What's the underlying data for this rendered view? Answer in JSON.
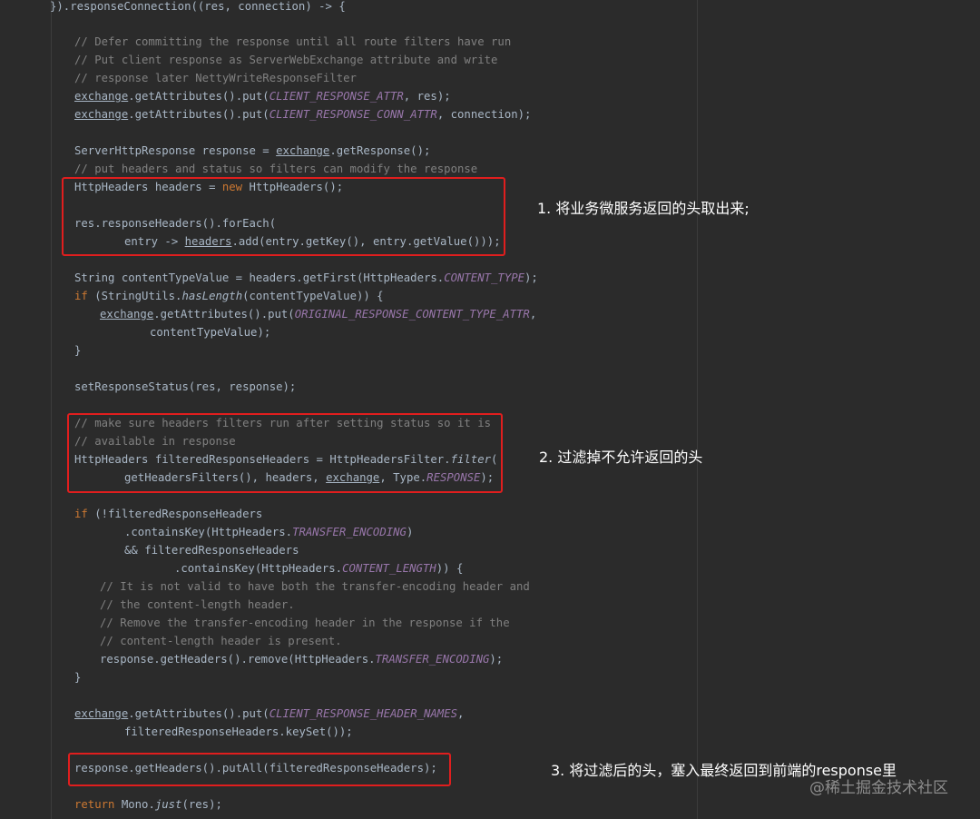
{
  "code": {
    "l0": [
      "}).responseConnection((res, connection) -> {"
    ],
    "l2": [
      "// Defer committing the response until all route filters have run"
    ],
    "l3": [
      "// Put client response as ServerWebExchange attribute and write"
    ],
    "l4": [
      "// response later NettyWriteResponseFilter"
    ],
    "l5": [
      "exchange",
      ".getAttributes().put(",
      "CLIENT_RESPONSE_ATTR",
      ", res);"
    ],
    "l6": [
      "exchange",
      ".getAttributes().put(",
      "CLIENT_RESPONSE_CONN_ATTR",
      ", connection);"
    ],
    "l8": [
      "ServerHttpResponse response = ",
      "exchange",
      ".getResponse();"
    ],
    "l9": [
      "// put headers and status so filters can modify the response"
    ],
    "l10": [
      "HttpHeaders headers = ",
      "new",
      " HttpHeaders();"
    ],
    "l12": [
      "res.responseHeaders().forEach("
    ],
    "l13": [
      "entry -> ",
      "headers",
      ".add(entry.getKey(), entry.getValue()));"
    ],
    "l15": [
      "String contentTypeValue = headers.getFirst(HttpHeaders.",
      "CONTENT_TYPE",
      ");"
    ],
    "l16": [
      "if",
      " (StringUtils.",
      "hasLength",
      "(contentTypeValue)) {"
    ],
    "l17": [
      "exchange",
      ".getAttributes().put(",
      "ORIGINAL_RESPONSE_CONTENT_TYPE_ATTR",
      ","
    ],
    "l18": [
      "contentTypeValue);"
    ],
    "l19": [
      "}"
    ],
    "l21": [
      "setResponseStatus(res, response);"
    ],
    "l23": [
      "// make sure headers filters run after setting status so it is"
    ],
    "l24": [
      "// available in response"
    ],
    "l25": [
      "HttpHeaders filteredResponseHeaders = HttpHeadersFilter.",
      "filter",
      "("
    ],
    "l26": [
      "getHeadersFilters(), headers, ",
      "exchange",
      ", Type.",
      "RESPONSE",
      ");"
    ],
    "l28": [
      "if",
      " (!filteredResponseHeaders"
    ],
    "l29": [
      ".containsKey(HttpHeaders.",
      "TRANSFER_ENCODING",
      ")"
    ],
    "l30": [
      "&& filteredResponseHeaders"
    ],
    "l31": [
      ".containsKey(HttpHeaders.",
      "CONTENT_LENGTH",
      ")) {"
    ],
    "l32": [
      "// It is not valid to have both the transfer-encoding header and"
    ],
    "l33": [
      "// the content-length header."
    ],
    "l34": [
      "// Remove the transfer-encoding header in the response if the"
    ],
    "l35": [
      "// content-length header is present."
    ],
    "l36": [
      "response.getHeaders().remove(HttpHeaders.",
      "TRANSFER_ENCODING",
      ");"
    ],
    "l37": [
      "}"
    ],
    "l39": [
      "exchange",
      ".getAttributes().put(",
      "CLIENT_RESPONSE_HEADER_NAMES",
      ","
    ],
    "l40": [
      "filteredResponseHeaders.keySet());"
    ],
    "l42": [
      "response.getHeaders().putAll(filteredResponseHeaders);"
    ],
    "l44": [
      "return",
      " Mono.",
      "just",
      "(res);"
    ]
  },
  "annotations": {
    "note1": "1. 将业务微服务返回的头取出来;",
    "note2": "2. 过滤掉不允许返回的头",
    "note3": "3. 将过滤后的头，塞入最终返回到前端的response里"
  },
  "watermark": "@稀土掘金技术社区",
  "colors": {
    "background": "#2b2b2b",
    "default_text": "#a9b7c6",
    "comment": "#808080",
    "keyword": "#cc7832",
    "constant": "#9876aa",
    "highlight_box": "#e01e1e",
    "annotation_text": "#ffffff"
  }
}
